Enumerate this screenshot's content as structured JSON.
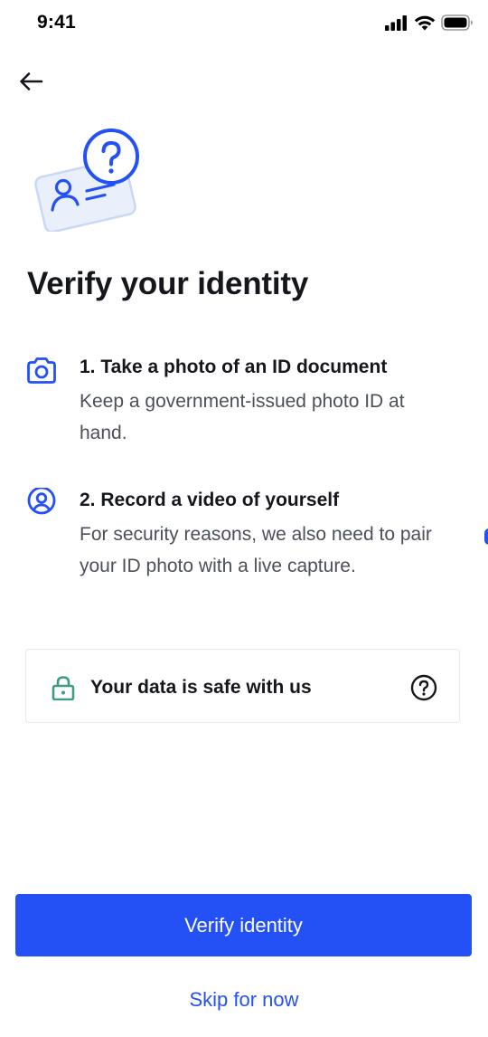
{
  "status_bar": {
    "time": "9:41",
    "icons": [
      "signal-icon",
      "wifi-icon",
      "battery-icon"
    ]
  },
  "nav": {
    "back_icon": "arrow-left-icon"
  },
  "hero": {
    "icon": "id-card-question-icon"
  },
  "title": "Verify your identity",
  "steps": [
    {
      "icon": "camera-icon",
      "title": "1. Take a photo of an ID document",
      "description": "Keep a government-issued photo ID at hand."
    },
    {
      "icon": "user-circle-icon",
      "title": "2. Record a video of yourself",
      "description": "For security reasons, we also need to pair your ID photo with a live capture."
    }
  ],
  "safety_card": {
    "icon": "lock-icon",
    "text": "Your data is safe with us",
    "help_icon": "question-circle-icon"
  },
  "actions": {
    "primary_label": "Verify identity",
    "secondary_label": "Skip for now"
  },
  "colors": {
    "accent": "#2351f5",
    "lock": "#3d9c83",
    "text_primary": "#15171c",
    "text_secondary": "#4b5058",
    "card_border": "#e7e9ec",
    "hero_card_fill": "#e9f0fc",
    "hero_card_stroke": "#c9d8f5"
  }
}
